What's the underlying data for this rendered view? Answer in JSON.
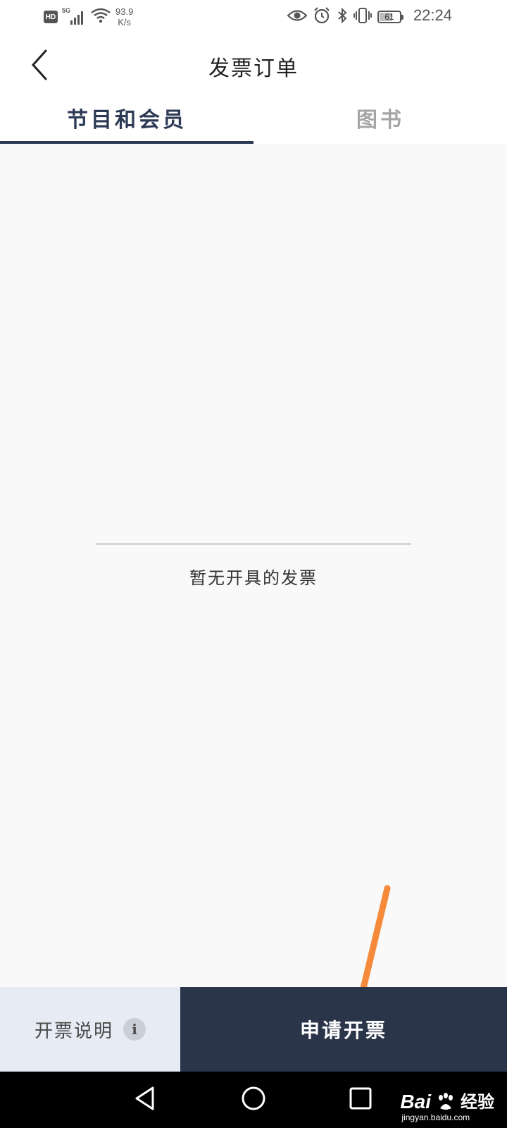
{
  "status_bar": {
    "hd_badge": "HD",
    "network": "5G",
    "speed_value": "93.9",
    "speed_unit": "K/s",
    "battery_level": "61",
    "time": "22:24",
    "icons": [
      "hd-icon",
      "signal-icon",
      "wifi-icon",
      "eye-icon",
      "alarm-icon",
      "bluetooth-icon",
      "vibrate-icon",
      "battery-icon"
    ]
  },
  "header": {
    "title": "发票订单",
    "back_icon": "chevron-left-icon"
  },
  "tabs": [
    {
      "label": "节目和会员",
      "active": true
    },
    {
      "label": "图书",
      "active": false
    }
  ],
  "content": {
    "empty_message": "暂无开具的发票"
  },
  "annotation": {
    "arrow_color": "#f48a3a"
  },
  "bottom_bar": {
    "info_label": "开票说明",
    "info_icon": "i",
    "apply_label": "申请开票"
  },
  "nav_bar": {
    "icons": [
      "nav-back-icon",
      "nav-home-icon",
      "nav-recents-icon"
    ]
  },
  "watermark": {
    "logo_text_left": "Bai",
    "logo_text_right": "经验",
    "url": "jingyan.baidu.com"
  },
  "colors": {
    "tab_active": "#2c3a55",
    "tab_inactive": "#a5a5a5",
    "primary_button": "#2b354a",
    "secondary_button": "#e7ebf3",
    "content_background": "#f9f9f9"
  }
}
